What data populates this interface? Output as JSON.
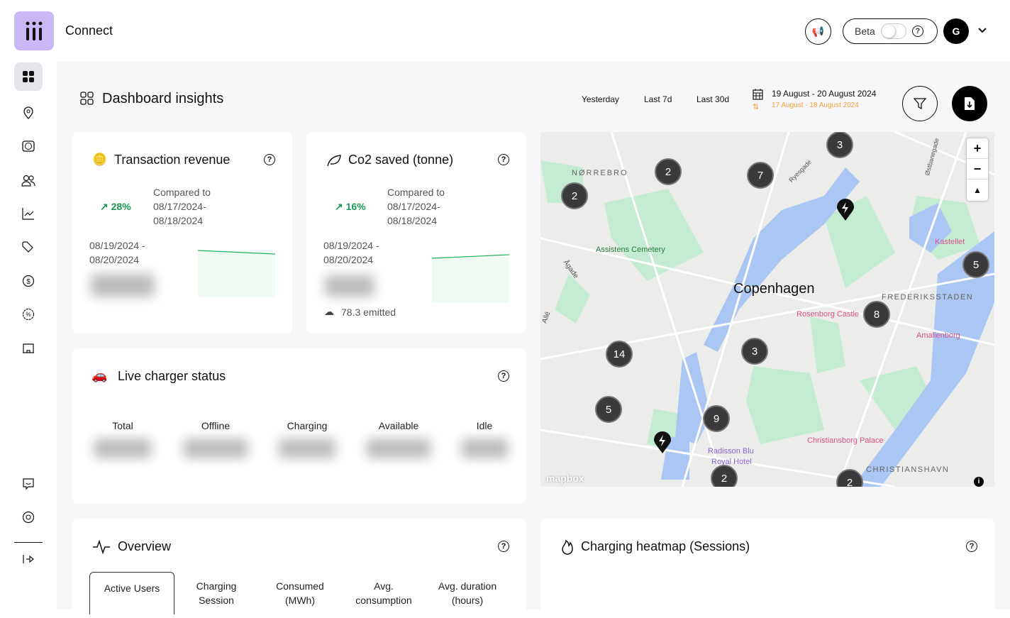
{
  "app": {
    "title": "Connect"
  },
  "header": {
    "beta_label": "Beta",
    "help": "?",
    "avatar_initial": "G"
  },
  "page": {
    "title": "Dashboard insights"
  },
  "ranges": [
    "Yesterday",
    "Last 7d",
    "Last 30d"
  ],
  "date": {
    "current": "19 August - 20 August 2024",
    "compare": "17 August - 18 August 2024"
  },
  "colors": {
    "accent": "#1a9a54",
    "compare": "#f5a03a",
    "logo": "#c9b8f3"
  },
  "revenue": {
    "title": "Transaction revenue",
    "pct": "28%",
    "compared_label": "Compared to",
    "compared_from": "08/17/2024-",
    "compared_to": "08/18/2024",
    "period_from": "08/19/2024 -",
    "period_to": "08/20/2024"
  },
  "co2": {
    "title": "Co2 saved (tonne)",
    "pct": "16%",
    "compared_label": "Compared to",
    "compared_from": "08/17/2024-",
    "compared_to": "08/18/2024",
    "period_from": "08/19/2024 -",
    "period_to": "08/20/2024",
    "emitted": "78.3 emitted"
  },
  "live": {
    "title": "Live charger status",
    "columns": [
      "Total",
      "Offline",
      "Charging",
      "Available",
      "Idle"
    ]
  },
  "overview": {
    "title": "Overview",
    "tabs": [
      [
        "Active Users"
      ],
      [
        "Charging",
        "Session"
      ],
      [
        "Consumed",
        "(MWh)"
      ],
      [
        "Avg.",
        "consumption"
      ],
      [
        "Avg. duration",
        "(hours)"
      ]
    ]
  },
  "heatmap": {
    "title": "Charging heatmap (Sessions)"
  },
  "map": {
    "clusters": [
      "3",
      "2",
      "7",
      "2",
      "5",
      "8",
      "3",
      "14",
      "5",
      "9",
      "2",
      "2"
    ],
    "labels": {
      "norrebro": "NØRREBRO",
      "assistens": "Assistens Cemetery",
      "copenhagen": "Copenhagen",
      "rosenborg": "Rosenborg Castle",
      "frederiksstaden": "FREDERIKSSTADEN",
      "kastellet": "Kastellet",
      "amalienborg": "Amalienborg",
      "christiansborg": "Christiansborg Palace",
      "radisson1": "Radisson Blu",
      "radisson2": "Royal Hotel",
      "christianshavn": "CHRISTIANSHAVN",
      "ryesgade": "Ryesgade",
      "ostbanegade": "Østbanegade",
      "agade": "Ågade",
      "alle": "Allé",
      "mapbox": "mapbox"
    },
    "zoom_in": "+",
    "zoom_out": "−"
  }
}
